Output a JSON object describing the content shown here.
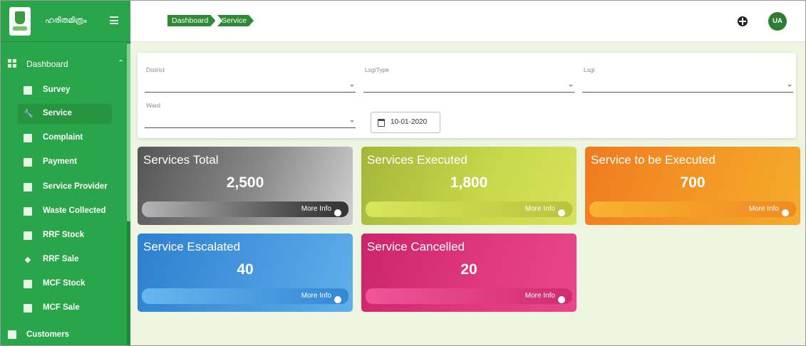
{
  "brand": {
    "name": "ഹരിതമിത്രം"
  },
  "breadcrumb": [
    "Dashboard",
    "Service"
  ],
  "header": {
    "avatar": "UA"
  },
  "sidebar": {
    "main": {
      "label": "Dashboard"
    },
    "items": [
      {
        "label": "Survey",
        "icon": "survey-icon"
      },
      {
        "label": "Service",
        "icon": "wrench-icon",
        "active": true
      },
      {
        "label": "Complaint",
        "icon": "complaint-icon"
      },
      {
        "label": "Payment",
        "icon": "payment-icon"
      },
      {
        "label": "Service Provider",
        "icon": "service-provider-icon"
      },
      {
        "label": "Waste Collected",
        "icon": "waste-icon"
      },
      {
        "label": "RRF Stock",
        "icon": "rrf-stock-icon"
      },
      {
        "label": "RRF Sale",
        "icon": "tag-icon"
      },
      {
        "label": "MCF Stock",
        "icon": "mcf-stock-icon"
      },
      {
        "label": "MCF Sale",
        "icon": "mcf-sale-icon"
      }
    ],
    "customers": {
      "label": "Customers"
    }
  },
  "filters": {
    "district_label": "District",
    "lsgi_type_label": "LsgiType",
    "lsgi_label": "Lsgi",
    "ward_label": "Ward",
    "date": "10-01-2020"
  },
  "cards": [
    {
      "title": "Services Total",
      "value": "2,500",
      "more": "More Info"
    },
    {
      "title": "Services Executed",
      "value": "1,800",
      "more": "More Info"
    },
    {
      "title": "Service to be Executed",
      "value": "700",
      "more": "More Info"
    },
    {
      "title": "Service Escalated",
      "value": "40",
      "more": "More Info"
    },
    {
      "title": "Service Cancelled",
      "value": "20",
      "more": "More Info"
    }
  ]
}
